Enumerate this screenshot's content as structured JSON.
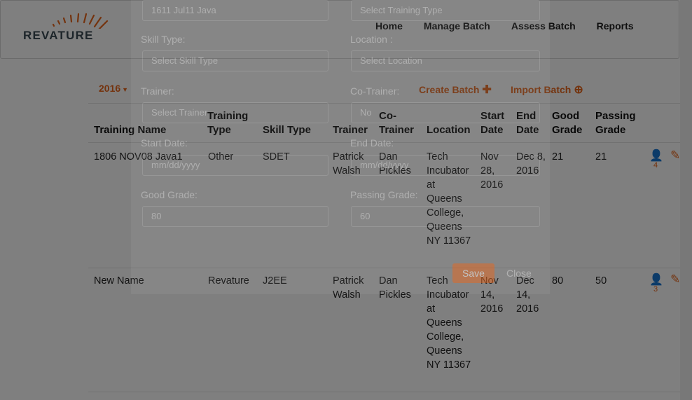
{
  "brand": {
    "logo_text": "REVATURE"
  },
  "nav": {
    "home": "Home",
    "manage_batch": "Manage Batch",
    "assess_batch": "Assess Batch",
    "reports": "Reports"
  },
  "toolbar": {
    "year": "2016",
    "create_batch": "Create Batch",
    "import_batch": "Import Batch"
  },
  "table": {
    "headers": {
      "training_name": "Training Name",
      "training_type": "Training Type",
      "skill_type": "Skill Type",
      "trainer": "Trainer",
      "co_trainer": "Co-Trainer",
      "location": "Location",
      "start_date": "Start Date",
      "end_date": "End Date",
      "good_grade": "Good Grade",
      "passing_grade": "Passing Grade"
    },
    "rows": [
      {
        "training_name": "1806 NOV08 Java1",
        "training_type": "Other",
        "skill_type": "SDET",
        "trainer": "Patrick Walsh",
        "co_trainer": "Dan Pickles",
        "location": "Tech Incubator at Queens College, Queens NY 11367",
        "start_date": "Nov 28, 2016",
        "end_date": "Dec 8, 2016",
        "good_grade": "21",
        "passing_grade": "21",
        "trainee_count": "4"
      },
      {
        "training_name": "New Name",
        "training_type": "Revature",
        "skill_type": "J2EE",
        "trainer": "Patrick Walsh",
        "co_trainer": "Dan Pickles",
        "location": "Tech Incubator at Queens College, Queens NY 11367",
        "start_date": "Nov 14, 2016",
        "end_date": "Dec 14, 2016",
        "good_grade": "80",
        "passing_grade": "50",
        "trainee_count": "3"
      }
    ]
  },
  "modal": {
    "training_name_value": "1611 Jul11 Java",
    "training_type_placeholder": "Select Training Type",
    "skill_type_label": "Skill Type:",
    "skill_type_placeholder": "Select Skill Type",
    "location_label": "Location :",
    "location_placeholder": "Select Location",
    "trainer_label": "Trainer:",
    "trainer_placeholder": "Select Trainer",
    "co_trainer_label": "Co-Trainer:",
    "co_trainer_placeholder": "No",
    "start_date_label": "Start Date:",
    "start_date_placeholder": "mm/dd/yyyy",
    "end_date_label": "End Date:",
    "end_date_placeholder": "mm/dd/yyyy",
    "good_grade_label": "Good Grade:",
    "good_grade_value": "80",
    "passing_grade_label": "Passing Grade:",
    "passing_grade_value": "60",
    "save": "Save",
    "close": "Close"
  },
  "colors": {
    "accent": "#e8671d"
  }
}
